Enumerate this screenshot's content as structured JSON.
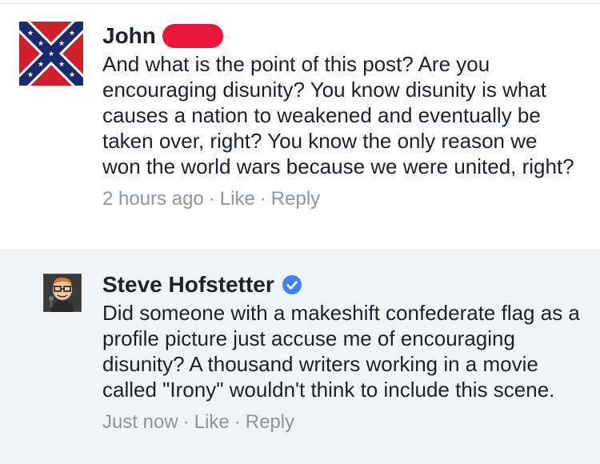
{
  "comments": [
    {
      "author": "John",
      "text": "And what is the point of this post? Are you encouraging disunity? You know disunity is what causes a nation to weakened and eventually be taken over, right? You know the only reason we won the world wars because we were united, right?",
      "time": "2 hours ago",
      "like_label": "Like",
      "reply_label": "Reply",
      "avatar_icon": "confederate-flag-avatar"
    },
    {
      "author": "Steve Hofstetter",
      "verified": true,
      "text": "Did someone with a makeshift confederate flag as a profile picture just accuse me of encouraging disunity? A thousand writers working in a movie called \"Irony\" wouldn't think to include this scene.",
      "time": "Just now",
      "like_label": "Like",
      "reply_label": "Reply",
      "avatar_icon": "cartoon-man-avatar"
    }
  ],
  "separator": "·",
  "colors": {
    "text": "#1d2129",
    "meta": "#90949c",
    "reply_bg": "#f2f3f5",
    "verified": "#4080ff",
    "redaction": "#e8163a"
  }
}
